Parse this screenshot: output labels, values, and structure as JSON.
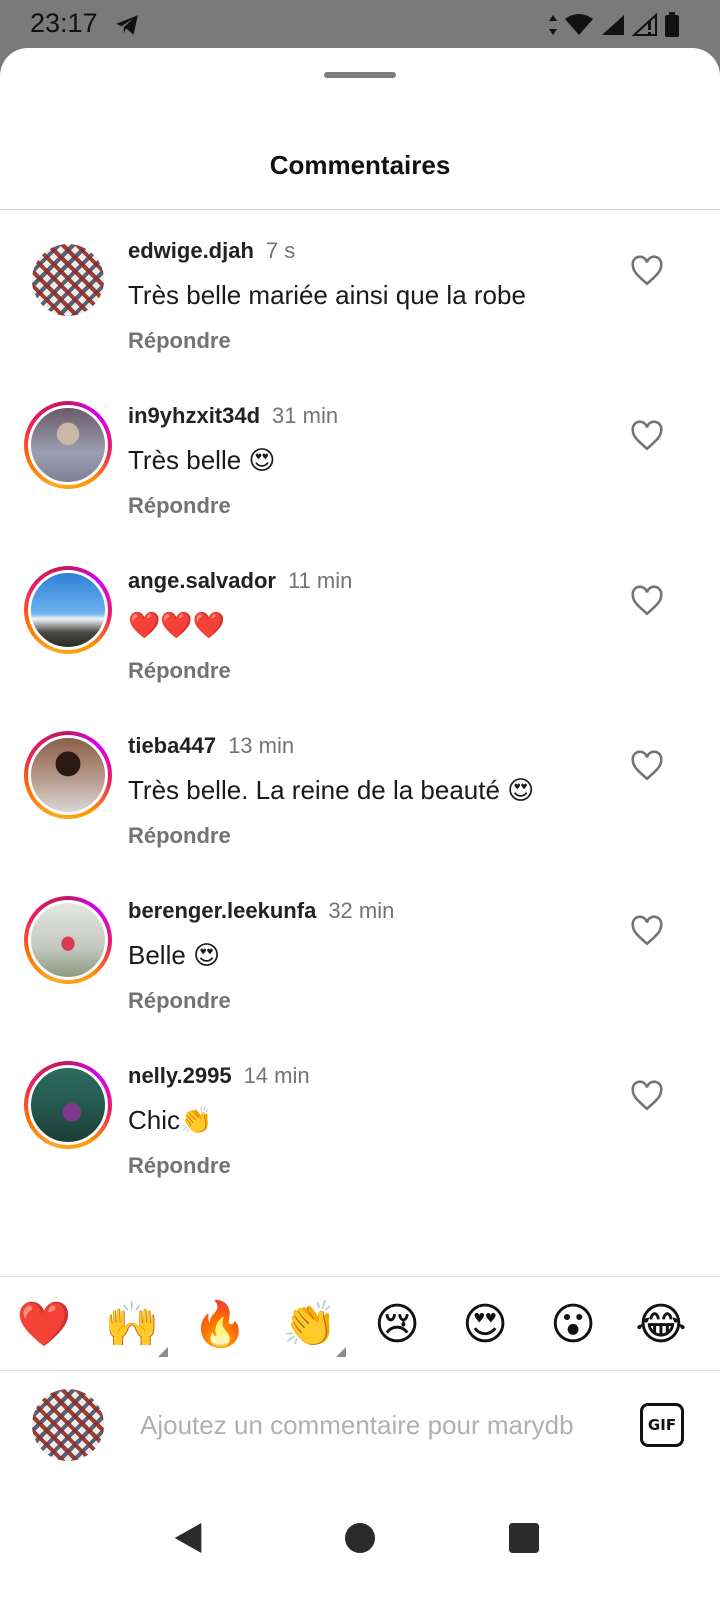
{
  "status_bar": {
    "time": "23:17"
  },
  "sheet": {
    "title": "Commentaires"
  },
  "comments": [
    {
      "username": "edwige.djah",
      "time": "7 s",
      "text": "Très belle mariée ainsi que la robe",
      "reply_label": "Répondre",
      "avatar": "pattern",
      "story_ring": false
    },
    {
      "username": "in9yhzxit34d",
      "time": "31 min",
      "text": "Très belle 😍",
      "reply_label": "Répondre",
      "avatar": "hoodie",
      "story_ring": true
    },
    {
      "username": "ange.salvador",
      "time": "11 min",
      "text": "❤️❤️❤️",
      "reply_label": "Répondre",
      "avatar": "sky",
      "story_ring": true
    },
    {
      "username": "tieba447",
      "time": "13 min",
      "text": "Très belle. La reine de la beauté 😍",
      "reply_label": "Répondre",
      "avatar": "man",
      "story_ring": true
    },
    {
      "username": "berenger.leekunfa",
      "time": "32 min",
      "text": "Belle 😍",
      "reply_label": "Répondre",
      "avatar": "person",
      "story_ring": true
    },
    {
      "username": "nelly.2995",
      "time": "14 min",
      "text": "Chic👏",
      "reply_label": "Répondre",
      "avatar": "room",
      "story_ring": true
    }
  ],
  "emoji_bar": [
    "❤️",
    "🙌",
    "🔥",
    "👏",
    "😢",
    "😍",
    "😮",
    "😂"
  ],
  "composer": {
    "placeholder": "Ajoutez un commentaire pour marydb",
    "gif_label": "GIF"
  },
  "colors": {
    "story_ring": "#e91e63",
    "secondary_text": "#737373",
    "heart": "#ed1c24"
  }
}
